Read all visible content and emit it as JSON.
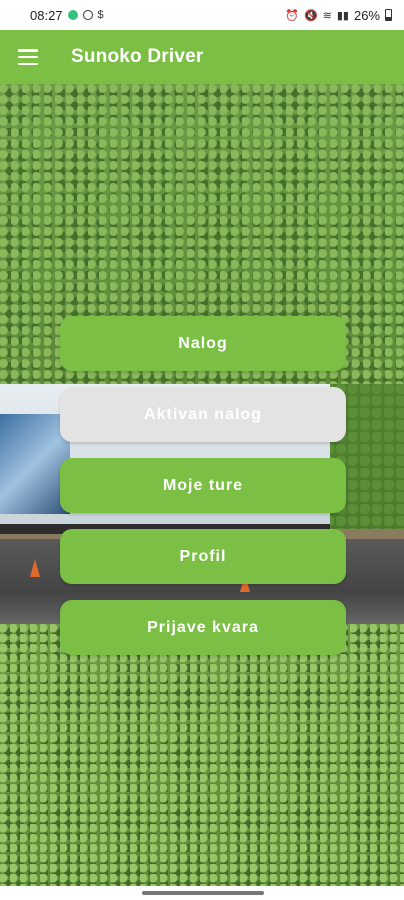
{
  "status_bar": {
    "time": "08:27",
    "battery": "26%"
  },
  "app_bar": {
    "title": "Sunoko Driver"
  },
  "menu": {
    "buttons": [
      {
        "label": "Nalog",
        "enabled": true
      },
      {
        "label": "Aktivan nalog",
        "enabled": false
      },
      {
        "label": "Moje ture",
        "enabled": true
      },
      {
        "label": "Profil",
        "enabled": true
      },
      {
        "label": "Prijave kvara",
        "enabled": true
      }
    ]
  },
  "colors": {
    "primary": "#7bbf45",
    "disabled": "#e3e3e3"
  }
}
